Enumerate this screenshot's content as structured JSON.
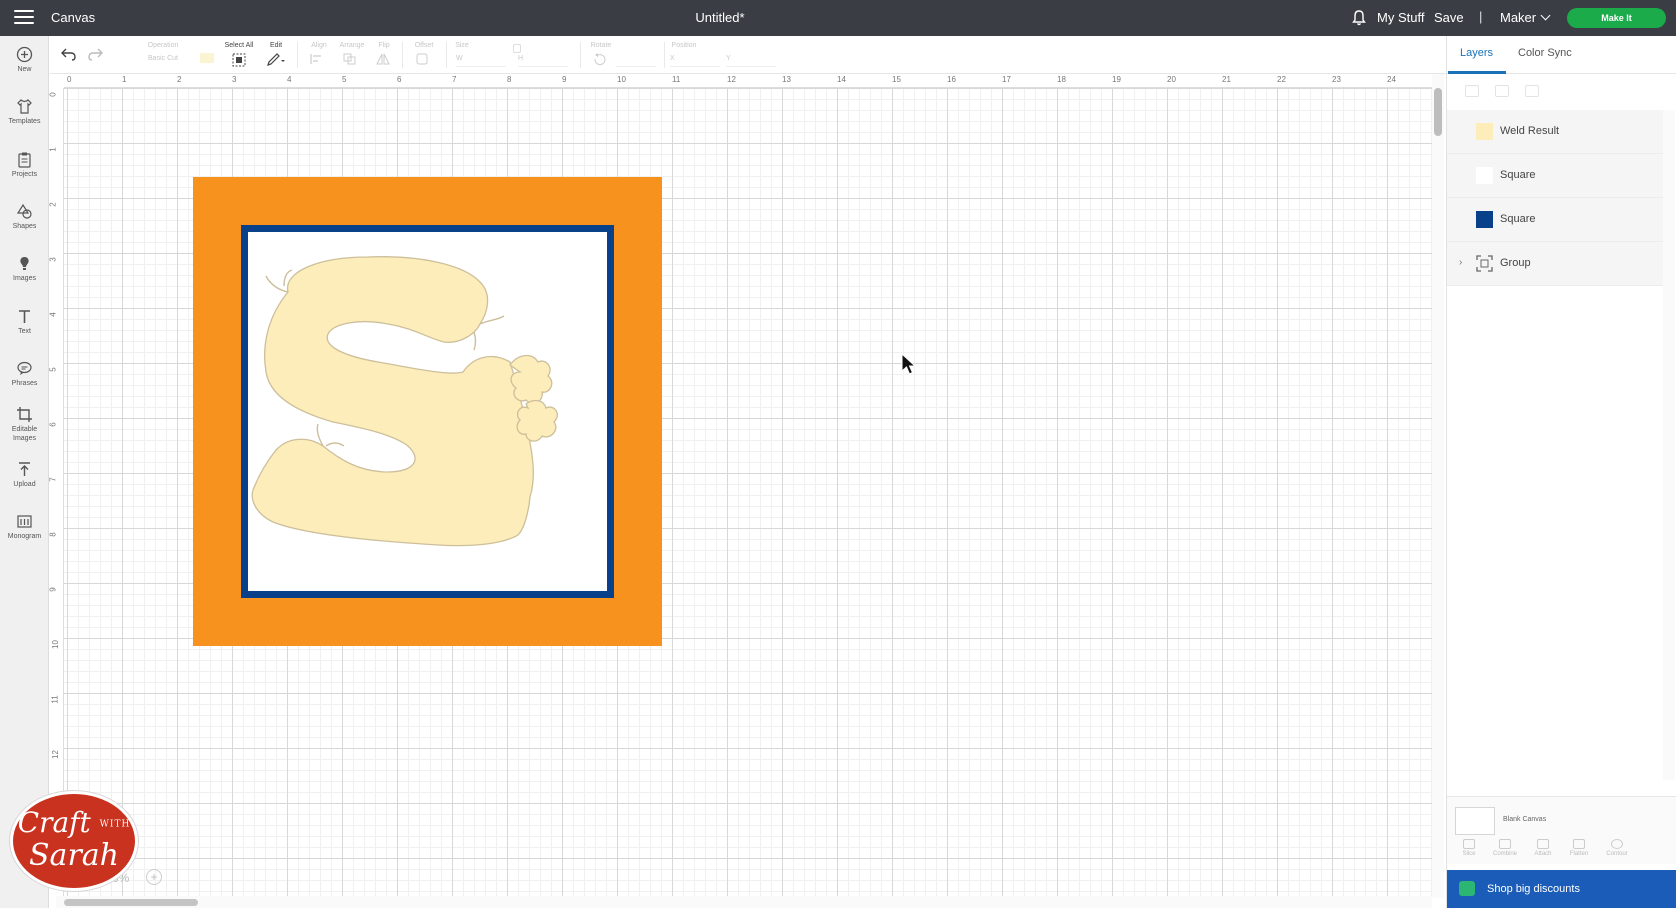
{
  "header": {
    "app_title": "Canvas",
    "document_title": "Untitled*",
    "my_stuff": "My Stuff",
    "save": "Save",
    "separator": "|",
    "machine": "Maker",
    "make_it": "Make It"
  },
  "left_tools": [
    {
      "label": "New",
      "icon": "plus-circle-icon"
    },
    {
      "label": "Templates",
      "icon": "shirt-icon"
    },
    {
      "label": "Projects",
      "icon": "clipboard-icon"
    },
    {
      "label": "Shapes",
      "icon": "shapes-icon"
    },
    {
      "label": "Images",
      "icon": "bulb-icon"
    },
    {
      "label": "Text",
      "icon": "text-icon"
    },
    {
      "label": "Phrases",
      "icon": "speech-bubble-icon"
    },
    {
      "label": "Editable Images",
      "icon": "crop-icon"
    },
    {
      "label": "Upload",
      "icon": "upload-icon"
    },
    {
      "label": "Monogram",
      "icon": "monogram-icon"
    }
  ],
  "toolbar": {
    "operation": "Operation",
    "operation_value": "Basic Cut",
    "select_all": "Select All",
    "edit": "Edit",
    "align": "Align",
    "arrange": "Arrange",
    "flip": "Flip",
    "offset": "Offset",
    "size": "Size",
    "w": "W",
    "h": "H",
    "rotate": "Rotate",
    "position": "Position",
    "x": "X",
    "y": "Y"
  },
  "rulers": {
    "top": [
      "0",
      "1",
      "2",
      "3",
      "4",
      "5",
      "6",
      "7",
      "8",
      "9",
      "10",
      "11",
      "12",
      "13",
      "14",
      "15",
      "16",
      "17",
      "18",
      "19",
      "20",
      "21",
      "22",
      "23",
      "24"
    ],
    "left": [
      "0",
      "1",
      "2",
      "3",
      "4",
      "5",
      "6",
      "7",
      "8",
      "9",
      "10",
      "11",
      "12"
    ]
  },
  "canvas": {
    "zoom": "0%",
    "zoom_plus": "+",
    "colors": {
      "orange_square": "#f7921e",
      "blue_square": "#08418a",
      "white_square": "#ffffff",
      "letter_fill": "#fdedbb"
    }
  },
  "watermark": {
    "line1": "Craft",
    "small": "WITH",
    "line2": "Sarah"
  },
  "right_panel": {
    "tabs": [
      "Layers",
      "Color Sync"
    ],
    "layers": [
      {
        "name": "Weld Result",
        "color": "#fdedbb",
        "icon": "swatch"
      },
      {
        "name": "Square",
        "color": "#ffffff",
        "icon": "swatch"
      },
      {
        "name": "Square",
        "color": "#08418a",
        "icon": "swatch"
      },
      {
        "name": "Group",
        "color": "",
        "icon": "group-icon",
        "expand": "›"
      }
    ],
    "blank_canvas": "Blank Canvas",
    "bottom_buttons": [
      "Slice",
      "Combine",
      "Attach",
      "Flatten",
      "Contour"
    ],
    "shop": "Shop big discounts"
  }
}
